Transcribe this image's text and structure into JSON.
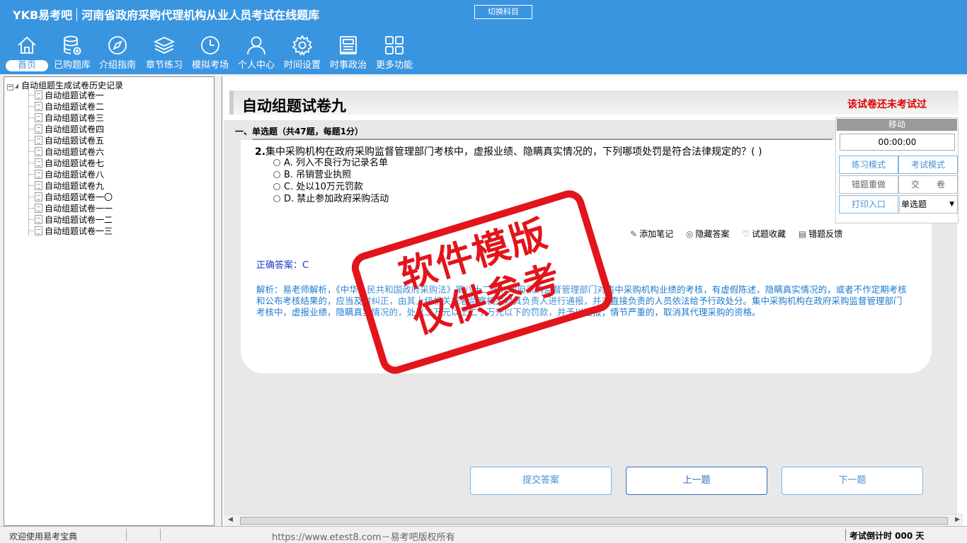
{
  "header": {
    "logo": "YKB易考吧",
    "app_title": "河南省政府采购代理机构从业人员考试在线题库",
    "switch_subject": "切换科目"
  },
  "nav": [
    {
      "label": "首页",
      "icon": "home-icon"
    },
    {
      "label": "已购题库",
      "icon": "database-icon"
    },
    {
      "label": "介绍指南",
      "icon": "compass-icon"
    },
    {
      "label": "章节练习",
      "icon": "layers-icon"
    },
    {
      "label": "模拟考场",
      "icon": "clock-icon"
    },
    {
      "label": "个人中心",
      "icon": "user-icon"
    },
    {
      "label": "时间设置",
      "icon": "gear-icon"
    },
    {
      "label": "时事政治",
      "icon": "news-icon"
    },
    {
      "label": "更多功能",
      "icon": "grid-icon"
    }
  ],
  "tree": {
    "root": "自动组题生成试卷历史记录",
    "items": [
      "自动组题试卷一",
      "自动组题试卷二",
      "自动组题试卷三",
      "自动组题试卷四",
      "自动组题试卷五",
      "自动组题试卷六",
      "自动组题试卷七",
      "自动组题试卷八",
      "自动组题试卷九",
      "自动组题试卷一〇",
      "自动组题试卷一一",
      "自动组题试卷一二",
      "自动组题试卷一三"
    ]
  },
  "main": {
    "paper_title": "自动组题试卷九",
    "status_note": "该试卷还未考试过",
    "section_heading": "一、单选题（共47题，每题1分）",
    "question": {
      "number": "2.",
      "text": "集中采购机构在政府采购监督管理部门考核中，虚报业绩、隐瞒真实情况的，下列哪项处罚是符合法律规定的？( )",
      "options": [
        "A. 列入不良行为记录名单",
        "B. 吊销营业执照",
        "C. 处以10万元罚款",
        "D. 禁止参加政府采购活动"
      ]
    },
    "actions": [
      {
        "label": "添加笔记",
        "icon": "pencil-icon"
      },
      {
        "label": "隐藏答案",
        "icon": "eye-icon"
      },
      {
        "label": "试题收藏",
        "icon": "heart-icon"
      },
      {
        "label": "错题反馈",
        "icon": "feedback-icon"
      }
    ],
    "answer_label": "正确答案：",
    "answer_value": "C",
    "analysis": "解析：易老师解析，《中华人民共和国政府采购法》第八十二条：政府采购监督管理部门对集中采购机构业绩的考核，有虚假陈述，隐瞒真实情况的，或者不作定期考核和公布考核结果的，应当及时纠正，由其上级机关或者监察机关对其负责人进行通报，并对直接负责的人员依法给予行政处分。集中采购机构在政府采购监督管理部门考核中，虚报业绩，隐瞒真实情况的，处以二万元以上二十万元以下的罚款，并予以通报；情节严重的，取消其代理采购的资格。",
    "buttons": {
      "submit": "提交答案",
      "prev": "上一题",
      "next": "下一题"
    }
  },
  "panel": {
    "move": "移动",
    "timer": "00:00:00",
    "practice_mode": "练习模式",
    "exam_mode": "考试模式",
    "redo_wrong": "错题重做",
    "hand_in": "交　　卷",
    "print": "打印入口",
    "type_select": "单选题"
  },
  "watermark": {
    "line1": "软件模版",
    "line2": "仅供参考"
  },
  "status": {
    "welcome": "欢迎使用易考宝典",
    "url": "https://www.etest8.com－易考吧版权所有",
    "countdown": "考试倒计时 000 天"
  },
  "colors": {
    "header_bg": "#3a95e0",
    "stamp_red": "#e3141b",
    "answer_blue": "#1a3bc8",
    "analysis_blue": "#1e7bd0"
  }
}
